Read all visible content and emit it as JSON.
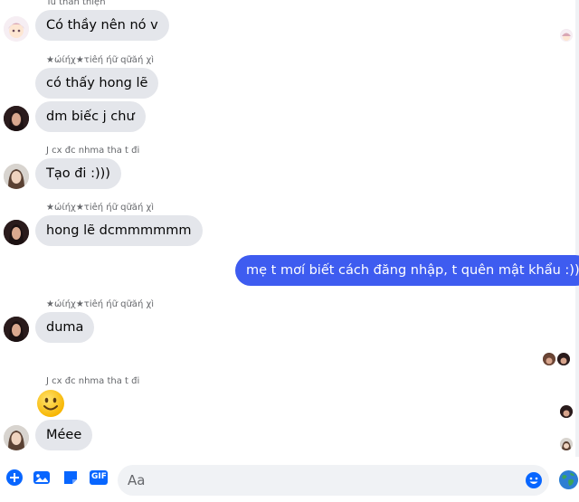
{
  "colors": {
    "accent": "#0866ff",
    "my_bubble": "#3e5cf0",
    "their_bubble": "#e4e6eb"
  },
  "messages": [
    {
      "sender": "Tú thân thiện",
      "text": "Có thầy nên nó v"
    },
    {
      "sender": "★ώίήχ★τiêή ήữ qữăή χì",
      "text": "có thấy hong lẽ"
    },
    {
      "text": "dm biếc j chư"
    },
    {
      "sender": "J cx đc nhma tha t đi",
      "text": "Tạo đi :)))"
    },
    {
      "sender": "★ώίήχ★τiêή ήữ qữăή χì",
      "text": "hong lẽ dcmmmmmm"
    },
    {
      "text": "mẹ t mơí biết cách đăng nhập, t quên mật khẩu :))"
    },
    {
      "sender": "★ώίήχ★τiêή ήữ qữăή χì",
      "text": "duma"
    },
    {
      "sender": "J cx đc nhma tha t đi",
      "text": "Méee"
    }
  ],
  "composer": {
    "placeholder": "Aa"
  },
  "icons": {
    "add": "plus-circle-icon",
    "image": "image-icon",
    "sticker": "sticker-icon",
    "gif": "gif-icon",
    "emoji": "emoji-icon",
    "send_like": "globe-icon"
  },
  "gif_label": "GIF"
}
